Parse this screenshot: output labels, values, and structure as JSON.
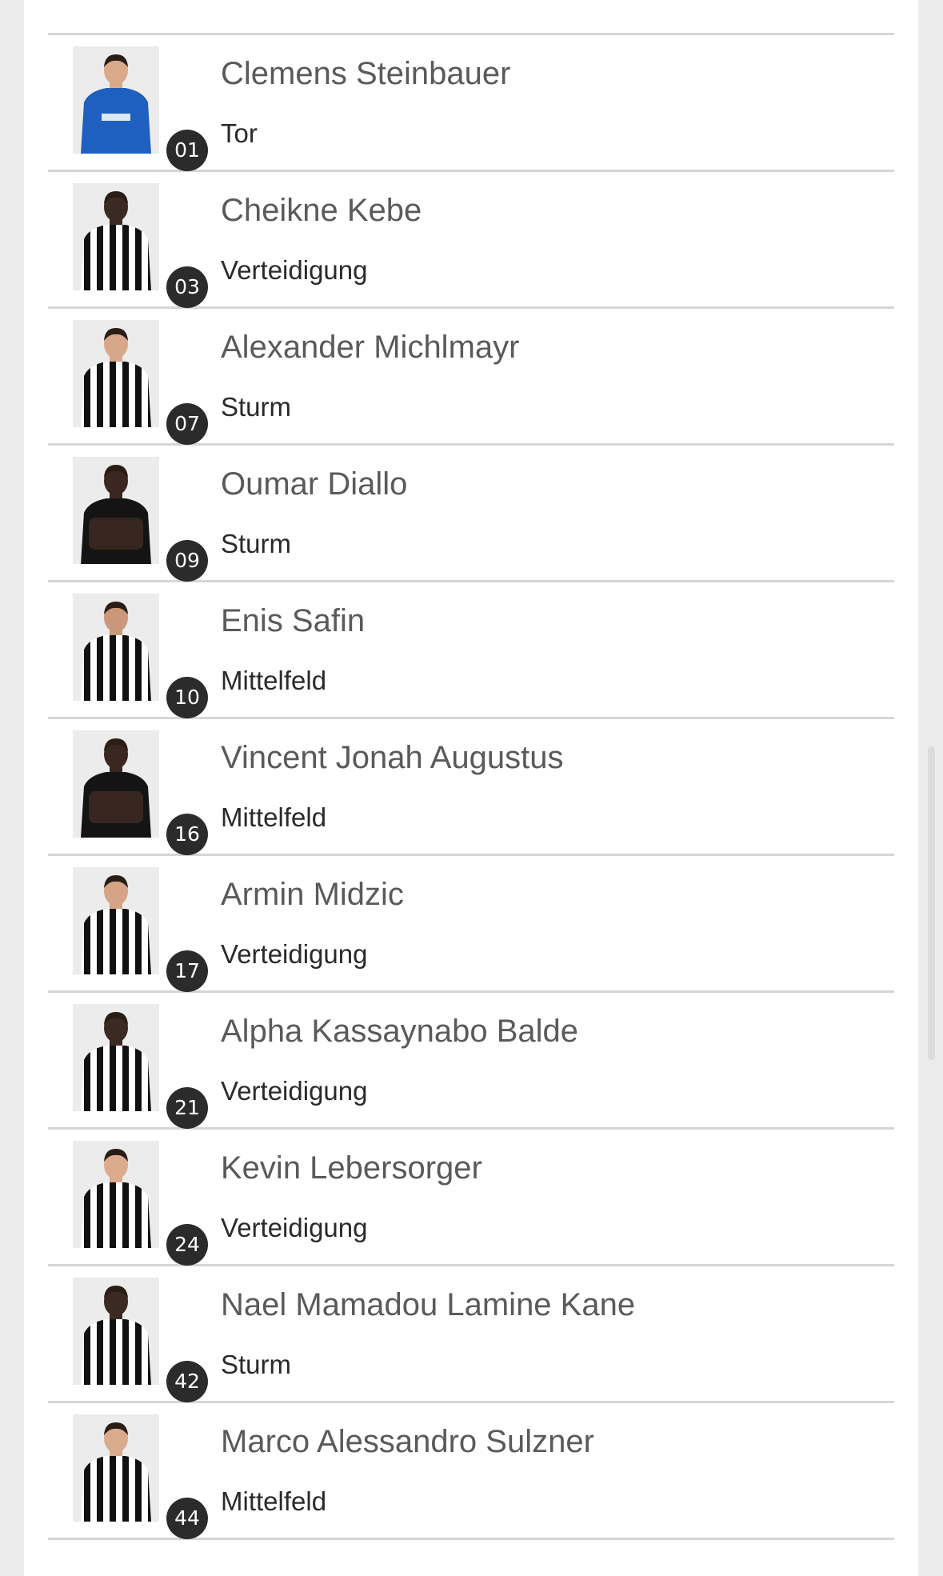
{
  "players": [
    {
      "number": "01",
      "name": "Clemens Steinbauer",
      "position": "Tor",
      "shirt": "blue",
      "skin": "#d9a98a"
    },
    {
      "number": "03",
      "name": "Cheikne Kebe",
      "position": "Verteidigung",
      "shirt": "stripes",
      "skin": "#3b2a22"
    },
    {
      "number": "07",
      "name": "Alexander Michlmayr",
      "position": "Sturm",
      "shirt": "stripes",
      "skin": "#d8a78a"
    },
    {
      "number": "09",
      "name": "Oumar Diallo",
      "position": "Sturm",
      "shirt": "black",
      "skin": "#3a2820"
    },
    {
      "number": "10",
      "name": "Enis Safin",
      "position": "Mittelfeld",
      "shirt": "stripes",
      "skin": "#c9977a"
    },
    {
      "number": "16",
      "name": "Vincent Jonah Augustus",
      "position": "Mittelfeld",
      "shirt": "black",
      "skin": "#3a2820"
    },
    {
      "number": "17",
      "name": "Armin Midzic",
      "position": "Verteidigung",
      "shirt": "stripes",
      "skin": "#d5a385"
    },
    {
      "number": "21",
      "name": "Alpha Kassaynabo Balde",
      "position": "Verteidigung",
      "shirt": "stripes",
      "skin": "#3b2a22"
    },
    {
      "number": "24",
      "name": "Kevin Lebersorger",
      "position": "Verteidigung",
      "shirt": "stripes",
      "skin": "#dbab8d"
    },
    {
      "number": "42",
      "name": "Nael Mamadou Lamine Kane",
      "position": "Sturm",
      "shirt": "stripes",
      "skin": "#3b2a22"
    },
    {
      "number": "44",
      "name": "Marco Alessandro Sulzner",
      "position": "Mittelfeld",
      "shirt": "stripes",
      "skin": "#dbab8d"
    }
  ],
  "colors": {
    "name_text": "#5a5a5a",
    "position_text": "#2a2a2a",
    "badge_bg": "#2b2b2b",
    "divider": "#d6d6d6",
    "shirt_blue": "#1f5fbf",
    "shirt_black": "#141414"
  }
}
